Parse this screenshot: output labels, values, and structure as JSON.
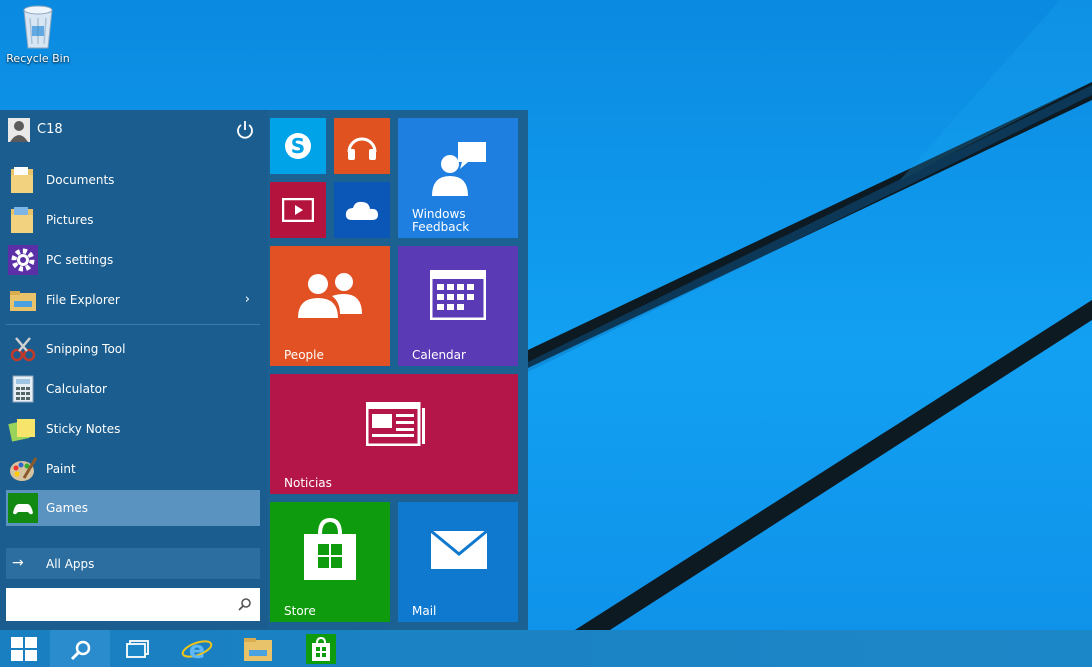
{
  "desktop": {
    "recycle_bin_label": "Recycle Bin"
  },
  "user": {
    "name": "C18"
  },
  "menu": {
    "pinned": [
      {
        "label": "Documents",
        "icon": "documents-folder-icon"
      },
      {
        "label": "Pictures",
        "icon": "pictures-folder-icon"
      },
      {
        "label": "PC settings",
        "icon": "gear-icon"
      },
      {
        "label": "File Explorer",
        "icon": "file-explorer-icon",
        "has_submenu": true
      }
    ],
    "apps": [
      {
        "label": "Snipping Tool",
        "icon": "snipping-tool-icon"
      },
      {
        "label": "Calculator",
        "icon": "calculator-icon"
      },
      {
        "label": "Sticky Notes",
        "icon": "sticky-notes-icon"
      },
      {
        "label": "Paint",
        "icon": "paint-icon"
      },
      {
        "label": "Games",
        "icon": "games-controller-icon",
        "selected": true
      }
    ],
    "all_apps_label": "All Apps",
    "search_value": "",
    "chevron": "›",
    "arrow": "→"
  },
  "tiles": {
    "skype": {
      "label": "",
      "color": "#00a2e8"
    },
    "music": {
      "label": "",
      "color": "#e05220"
    },
    "video": {
      "label": "",
      "color": "#b4133e"
    },
    "onedrive": {
      "label": "",
      "color": "#0b57b8"
    },
    "feedback": {
      "label": "Windows\nFeedback",
      "color": "#1e7fe0"
    },
    "people": {
      "label": "People",
      "color": "#e15123"
    },
    "calendar": {
      "label": "Calendar",
      "color": "#5b3ab5"
    },
    "news": {
      "label": "Noticias",
      "color": "#b5164a"
    },
    "store": {
      "label": "Store",
      "color": "#0e9c0e"
    },
    "mail": {
      "label": "Mail",
      "color": "#0f78cf"
    }
  },
  "taskbar": {
    "items": [
      "start-button",
      "search-button",
      "task-view-button",
      "internet-explorer-button",
      "file-explorer-button",
      "store-button"
    ]
  },
  "colors": {
    "start_menu_bg": "#1b5d8e",
    "selected_item": "#5a93c0",
    "accent": "#0f93ea"
  }
}
